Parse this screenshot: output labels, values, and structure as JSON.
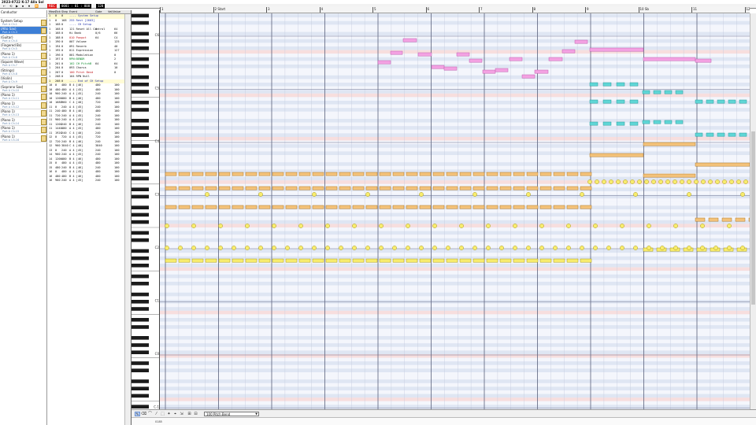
{
  "title": "2023-0722 K-17 Alla Sol",
  "toolbar": {
    "buttons": [
      "←",
      "⟲",
      "▶",
      "⏹",
      "⏺",
      "⏩"
    ],
    "position": "0001 : 01 : 000",
    "tempo": "120",
    "record": "REC"
  },
  "tracks": [
    {
      "name": "Conductor",
      "sub": ""
    },
    {
      "name": "System Setup",
      "sub": "Port A Ch.1"
    },
    {
      "name": "(Alto Sax)",
      "sub": "Port A Ch.3",
      "selected": true
    },
    {
      "name": "(Guitar)",
      "sub": "Port A Ch.4"
    },
    {
      "name": "(Fingered Bs)",
      "sub": "Port A Ch.5"
    },
    {
      "name": "(Piano 1)",
      "sub": "Port A Ch.6"
    },
    {
      "name": "(Square Wave)",
      "sub": "Port A Ch.7"
    },
    {
      "name": "(Strings)",
      "sub": "Port A Ch.8"
    },
    {
      "name": "(Violin)",
      "sub": "Port A Ch.9"
    },
    {
      "name": "(Soprano Sax)",
      "sub": "Port A Ch.10"
    },
    {
      "name": "(Piano 1)",
      "sub": "Port A Ch.11"
    },
    {
      "name": "(Piano 1)",
      "sub": "Port A Ch.12"
    },
    {
      "name": "(Piano 1)",
      "sub": "Port A Ch.13"
    },
    {
      "name": "(Piano 1)",
      "sub": "Port A Ch.14"
    },
    {
      "name": "(Piano 1)",
      "sub": "Port A Ch.15"
    },
    {
      "name": "(Piano 1)",
      "sub": "Port A Ch.16"
    }
  ],
  "eventlist": {
    "headers": [
      "Meas",
      "Tick",
      "Step",
      "Event",
      "Gate",
      "Vel/Value"
    ],
    "rows": [
      [
        "1",
        "0",
        "0",
        "---- System Setup",
        "",
        ""
      ],
      [
        "1",
        "0",
        "168",
        "255 Rest [2603]",
        "",
        "",
        ""
      ],
      [
        "1",
        "168",
        "0",
        "---- CH Setup",
        "",
        ""
      ],
      [
        "1",
        "168",
        "0",
        "121 Reset All Control",
        "0",
        "64"
      ],
      [
        "1",
        "168",
        "0",
        "Hi Bank",
        "0/6",
        "66"
      ],
      [
        "1",
        "188",
        "0",
        "010 Panpot",
        "64",
        "C4"
      ],
      [
        "1",
        "190",
        "0",
        "007 Volume",
        "",
        "125"
      ],
      [
        "1",
        "194",
        "0",
        "091 Reverb",
        "",
        "40"
      ],
      [
        "1",
        "195",
        "0",
        "011 Expression",
        "",
        "127"
      ],
      [
        "1",
        "196",
        "0",
        "001 Modulation",
        "",
        "0"
      ],
      [
        "1",
        "197",
        "0",
        "RPN:BENDR",
        "",
        "2"
      ],
      [
        "1",
        "201",
        "0",
        "102 CH PitchB",
        "64",
        "64"
      ],
      [
        "1",
        "204",
        "0",
        "093 Chorus",
        "",
        "10"
      ],
      [
        "1",
        "207",
        "0",
        "100 Pitch Bend",
        "",
        "0"
      ],
      [
        "1",
        "208",
        "0",
        "104 RPN Null",
        "",
        ""
      ],
      [
        "1",
        "208",
        "0",
        "---- End of CH Setup",
        "",
        ""
      ],
      [
        "10",
        "0",
        "480",
        "B 4 [46]",
        "480",
        "100"
      ],
      [
        "10",
        "480",
        "480",
        "A 4 [45]",
        "480",
        "100"
      ],
      [
        "10",
        "960",
        "240",
        "A 4 [45]",
        "240",
        "100"
      ],
      [
        "10",
        "1200",
        "480",
        "B 4 [46]",
        "480",
        "100"
      ],
      [
        "10",
        "1680",
        "960",
        "C 4 [40]",
        "720",
        "100"
      ],
      [
        "11",
        "0",
        "240",
        "A 4 [45]",
        "240",
        "100"
      ],
      [
        "11",
        "240",
        "480",
        "B 4 [46]",
        "480",
        "100"
      ],
      [
        "11",
        "720",
        "240",
        "A 4 [45]",
        "240",
        "100"
      ],
      [
        "11",
        "960",
        "240",
        "A 4 [45]",
        "240",
        "100"
      ],
      [
        "11",
        "1200",
        "240",
        "B 4 [46]",
        "240",
        "100"
      ],
      [
        "11",
        "1440",
        "480",
        "A 4 [45]",
        "480",
        "100"
      ],
      [
        "11",
        "1920",
        "240",
        "C 4 [40]",
        "240",
        "100"
      ],
      [
        "12",
        "0",
        "720",
        "A 4 [45]",
        "720",
        "100"
      ],
      [
        "12",
        "720",
        "240",
        "B 4 [46]",
        "240",
        "100"
      ],
      [
        "12",
        "960",
        "3840",
        "C 4 [40]",
        "3840",
        "100"
      ],
      [
        "13",
        "0",
        "240",
        "A 4 [45]",
        "240",
        "100"
      ],
      [
        "14",
        "960",
        "240",
        "A 4 [45]",
        "240",
        "100"
      ],
      [
        "14",
        "1200",
        "480",
        "B 4 [46]",
        "480",
        "100"
      ],
      [
        "15",
        "0",
        "480",
        "A 4 [45]",
        "480",
        "100"
      ],
      [
        "15",
        "480",
        "240",
        "B 4 [46]",
        "240",
        "100"
      ],
      [
        "16",
        "0",
        "480",
        "A 4 [45]",
        "480",
        "100"
      ],
      [
        "16",
        "480",
        "480",
        "B 4 [46]",
        "480",
        "100"
      ],
      [
        "16",
        "960",
        "240",
        "A 4 [45]",
        "240",
        "100"
      ]
    ]
  },
  "ruler": {
    "measures": [
      "1",
      "2 Start",
      "3",
      "4",
      "5",
      "6",
      "7",
      "8",
      "9",
      "10 Sb",
      "11",
      "12"
    ]
  },
  "piano_labels": [
    "C6",
    "C5",
    "C4",
    "C3",
    "C2",
    "C1",
    "C0",
    "C-1"
  ],
  "bottom": {
    "controller": "100 Pitch Bend",
    "tools": [
      "✎",
      "⌫",
      "⌒",
      "⁄",
      "⬚",
      "✦",
      "⌖",
      "⇲",
      "⊞",
      "⊟"
    ],
    "zoom": "0185"
  },
  "colors": {
    "pink": "#f3a2e2",
    "cyan": "#5fd6d6",
    "orange": "#f3c27a",
    "yellow": "#f8ec6e",
    "selected_track": "#3d7fd6"
  }
}
